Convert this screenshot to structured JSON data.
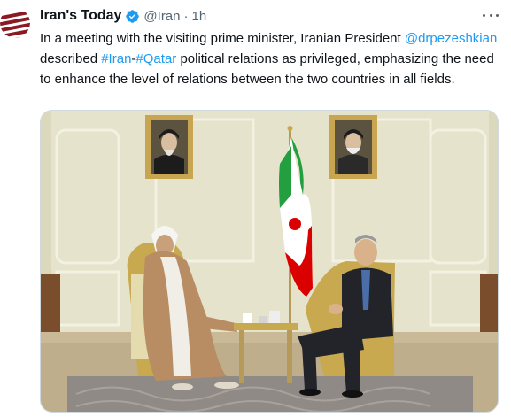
{
  "author": {
    "display_name": "Iran's Today",
    "handle": "@Iran",
    "separator": "·",
    "time": "1h",
    "verified_icon": "verified-badge-icon",
    "avatar_icon": "striped-globe-logo"
  },
  "tweet": {
    "text_1": "In a meeting with the visiting prime minister, Iranian President ",
    "mention": "@drpezeshkian",
    "text_2": " described ",
    "hashtag_1": "#Iran",
    "text_3": "-",
    "hashtag_2": "#Qatar",
    "text_4": " political relations as privileged, emphasizing the need to enhance the level of relations between the two countries in all fields."
  },
  "media": {
    "description_icon": "photo-meeting-room",
    "flag_colors": [
      "#239f40",
      "#ffffff",
      "#da0000"
    ]
  },
  "colors": {
    "link": "#1d9bf0",
    "secondary_text": "#536471",
    "primary_text": "#0f1419"
  }
}
